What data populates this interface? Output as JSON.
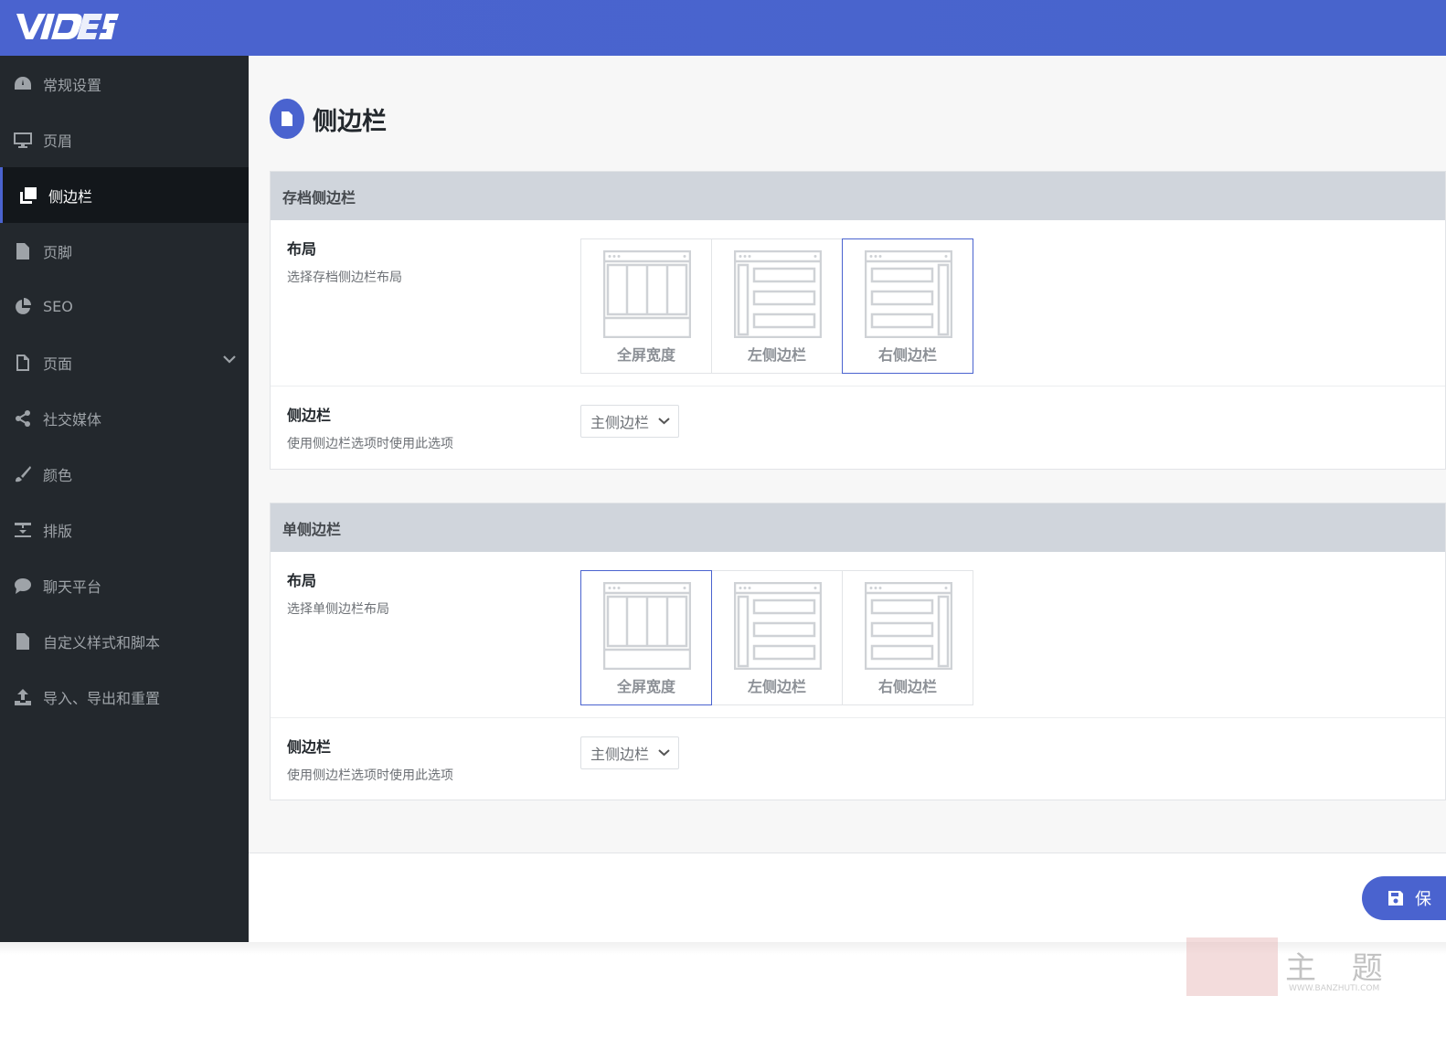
{
  "brand": {
    "accent": "#4a63cf",
    "sidebar_bg": "#23282d"
  },
  "sidebar": {
    "items": [
      {
        "label": "常规设置",
        "icon": "dashboard-icon"
      },
      {
        "label": "页眉",
        "icon": "desktop-icon"
      },
      {
        "label": "侧边栏",
        "icon": "copy-icon",
        "active": true
      },
      {
        "label": "页脚",
        "icon": "file-icon"
      },
      {
        "label": "SEO",
        "icon": "pie-chart-icon"
      },
      {
        "label": "页面",
        "icon": "file-outline-icon",
        "has_children": true
      },
      {
        "label": "社交媒体",
        "icon": "share-icon"
      },
      {
        "label": "颜色",
        "icon": "paint-brush-icon"
      },
      {
        "label": "排版",
        "icon": "text-height-icon"
      },
      {
        "label": "聊天平台",
        "icon": "comment-icon"
      },
      {
        "label": "自定义样式和脚本",
        "icon": "file-icon"
      },
      {
        "label": "导入、导出和重置",
        "icon": "upload-icon"
      }
    ]
  },
  "page": {
    "title": "侧边栏",
    "icon": "file-icon"
  },
  "sections": [
    {
      "title": "存档侧边栏",
      "layout": {
        "label": "布局",
        "desc": "选择存档侧边栏布局",
        "options": [
          "全屏宽度",
          "左侧边栏",
          "右侧边栏"
        ],
        "selected": "右侧边栏"
      },
      "sidebar_select": {
        "label": "侧边栏",
        "desc": "使用侧边栏选项时使用此选项",
        "value": "主侧边栏"
      }
    },
    {
      "title": "单侧边栏",
      "layout": {
        "label": "布局",
        "desc": "选择单侧边栏布局",
        "options": [
          "全屏宽度",
          "左侧边栏",
          "右侧边栏"
        ],
        "selected": "全屏宽度"
      },
      "sidebar_select": {
        "label": "侧边栏",
        "desc": "使用侧边栏选项时使用此选项",
        "value": "主侧边栏"
      }
    }
  ],
  "footer": {
    "save_label": "保"
  },
  "watermark": {
    "text": "主 题",
    "url": "WWW.BANZHUTI.COM"
  }
}
